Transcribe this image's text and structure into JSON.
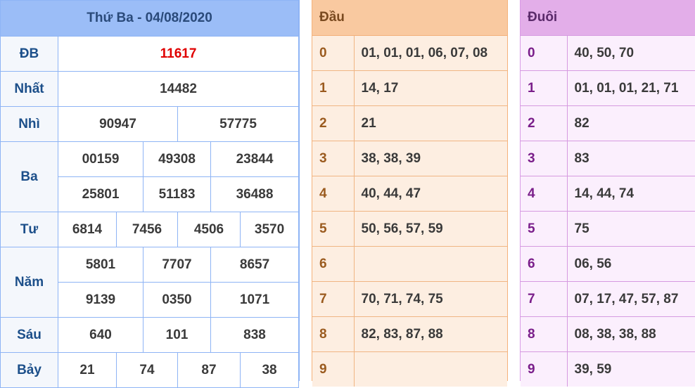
{
  "results": {
    "title": "Thứ Ba - 04/08/2020",
    "rows": {
      "db": {
        "label": "ĐB",
        "values": [
          "11617"
        ]
      },
      "nhat": {
        "label": "Nhất",
        "values": [
          "14482"
        ]
      },
      "nhi": {
        "label": "Nhì",
        "values": [
          "90947",
          "57775"
        ]
      },
      "ba": {
        "label": "Ba",
        "values": [
          "00159",
          "49308",
          "23844",
          "25801",
          "51183",
          "36488"
        ]
      },
      "tu": {
        "label": "Tư",
        "values": [
          "6814",
          "7456",
          "4506",
          "3570"
        ]
      },
      "nam": {
        "label": "Năm",
        "values": [
          "5801",
          "7707",
          "8657",
          "9139",
          "0350",
          "1071"
        ]
      },
      "sau": {
        "label": "Sáu",
        "values": [
          "640",
          "101",
          "838"
        ]
      },
      "bay": {
        "label": "Bảy",
        "values": [
          "21",
          "74",
          "87",
          "38"
        ]
      }
    },
    "special_color": "#e00000"
  },
  "dau": {
    "header": "Đầu",
    "rows": [
      {
        "key": "0",
        "value": "01, 01, 01, 06, 07, 08"
      },
      {
        "key": "1",
        "value": "14, 17"
      },
      {
        "key": "2",
        "value": "21"
      },
      {
        "key": "3",
        "value": "38, 38, 39"
      },
      {
        "key": "4",
        "value": "40, 44, 47"
      },
      {
        "key": "5",
        "value": "50, 56, 57, 59"
      },
      {
        "key": "6",
        "value": ""
      },
      {
        "key": "7",
        "value": "70, 71, 74, 75"
      },
      {
        "key": "8",
        "value": "82, 83, 87, 88"
      },
      {
        "key": "9",
        "value": ""
      }
    ]
  },
  "duoi": {
    "header": "Đuôi",
    "rows": [
      {
        "key": "0",
        "value": "40, 50, 70"
      },
      {
        "key": "1",
        "value": "01, 01, 01, 21, 71"
      },
      {
        "key": "2",
        "value": "82"
      },
      {
        "key": "3",
        "value": "83"
      },
      {
        "key": "4",
        "value": "14, 44, 74"
      },
      {
        "key": "5",
        "value": "75"
      },
      {
        "key": "6",
        "value": "06, 56"
      },
      {
        "key": "7",
        "value": "07, 17, 47, 57, 87"
      },
      {
        "key": "8",
        "value": "08, 38, 38, 88"
      },
      {
        "key": "9",
        "value": "39, 59"
      }
    ]
  }
}
